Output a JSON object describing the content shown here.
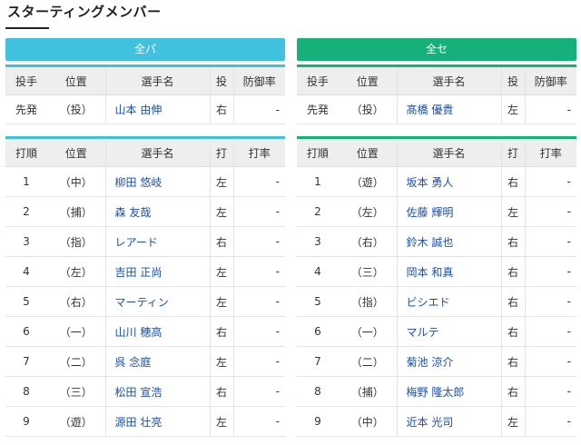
{
  "page": {
    "title": "スターティングメンバー"
  },
  "teams": [
    {
      "name": "全パ",
      "pitcher_headers": {
        "role": "投手",
        "position": "位置",
        "player": "選手名",
        "throws": "投",
        "era": "防御率"
      },
      "pitcher": {
        "role": "先発",
        "position": "（投）",
        "name": "山本 由伸",
        "throws": "右",
        "era": "-"
      },
      "lineup_headers": {
        "order": "打順",
        "position": "位置",
        "player": "選手名",
        "bats": "打",
        "avg": "打率"
      },
      "lineup": [
        {
          "order": "1",
          "position": "（中）",
          "name": "柳田 悠岐",
          "bats": "左",
          "avg": "-"
        },
        {
          "order": "2",
          "position": "（捕）",
          "name": "森 友哉",
          "bats": "左",
          "avg": "-"
        },
        {
          "order": "3",
          "position": "（指）",
          "name": "レアード",
          "bats": "右",
          "avg": "-"
        },
        {
          "order": "4",
          "position": "（左）",
          "name": "吉田 正尚",
          "bats": "左",
          "avg": "-"
        },
        {
          "order": "5",
          "position": "（右）",
          "name": "マーティン",
          "bats": "左",
          "avg": "-"
        },
        {
          "order": "6",
          "position": "（一）",
          "name": "山川 穂高",
          "bats": "右",
          "avg": "-"
        },
        {
          "order": "7",
          "position": "（二）",
          "name": "呉 念庭",
          "bats": "左",
          "avg": "-"
        },
        {
          "order": "8",
          "position": "（三）",
          "name": "松田 宣浩",
          "bats": "右",
          "avg": "-"
        },
        {
          "order": "9",
          "position": "（遊）",
          "name": "源田 壮亮",
          "bats": "左",
          "avg": "-"
        }
      ]
    },
    {
      "name": "全セ",
      "pitcher_headers": {
        "role": "投手",
        "position": "位置",
        "player": "選手名",
        "throws": "投",
        "era": "防御率"
      },
      "pitcher": {
        "role": "先発",
        "position": "（投）",
        "name": "髙橋 優貴",
        "throws": "左",
        "era": "-"
      },
      "lineup_headers": {
        "order": "打順",
        "position": "位置",
        "player": "選手名",
        "bats": "打",
        "avg": "打率"
      },
      "lineup": [
        {
          "order": "1",
          "position": "（遊）",
          "name": "坂本 勇人",
          "bats": "右",
          "avg": "-"
        },
        {
          "order": "2",
          "position": "（左）",
          "name": "佐藤 輝明",
          "bats": "左",
          "avg": "-"
        },
        {
          "order": "3",
          "position": "（右）",
          "name": "鈴木 誠也",
          "bats": "右",
          "avg": "-"
        },
        {
          "order": "4",
          "position": "（三）",
          "name": "岡本 和真",
          "bats": "右",
          "avg": "-"
        },
        {
          "order": "5",
          "position": "（指）",
          "name": "ビシエド",
          "bats": "右",
          "avg": "-"
        },
        {
          "order": "6",
          "position": "（一）",
          "name": "マルテ",
          "bats": "右",
          "avg": "-"
        },
        {
          "order": "7",
          "position": "（二）",
          "name": "菊池 涼介",
          "bats": "右",
          "avg": "-"
        },
        {
          "order": "8",
          "position": "（捕）",
          "name": "梅野 隆太郎",
          "bats": "右",
          "avg": "-"
        },
        {
          "order": "9",
          "position": "（中）",
          "name": "近本 光司",
          "bats": "左",
          "avg": "-"
        }
      ]
    }
  ],
  "colors": {
    "pacific_accent": "#3fc1df",
    "central_accent": "#16b07b",
    "player_link": "#1a4fb0"
  }
}
